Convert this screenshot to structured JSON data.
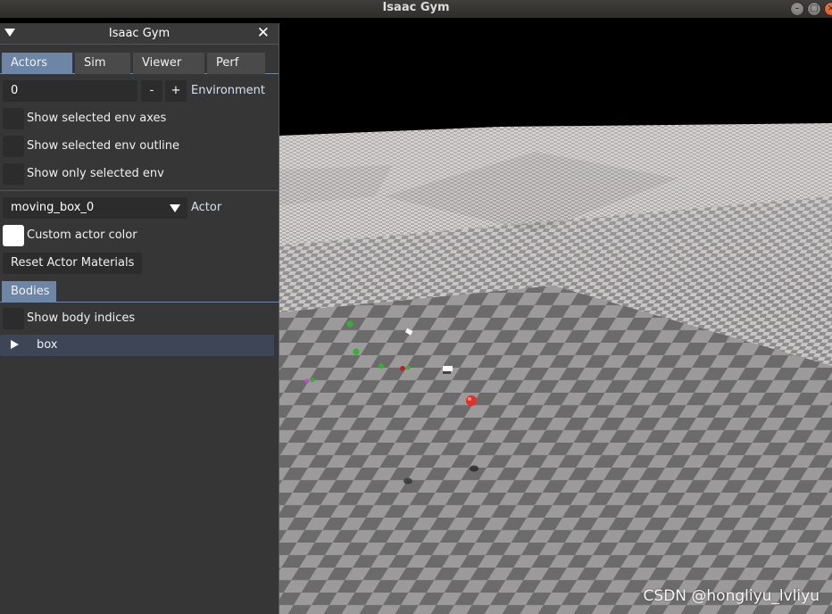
{
  "window": {
    "title": "Isaac Gym"
  },
  "panel": {
    "title": "Isaac Gym",
    "tabs": [
      {
        "label": "Actors",
        "active": true
      },
      {
        "label": "Sim",
        "active": false
      },
      {
        "label": "Viewer",
        "active": false
      },
      {
        "label": "Perf",
        "active": false
      }
    ],
    "environment": {
      "value": "0",
      "minus": "-",
      "plus": "+",
      "label": "Environment"
    },
    "env_checkboxes": [
      {
        "label": "Show selected env axes",
        "checked": false
      },
      {
        "label": "Show selected env outline",
        "checked": false
      },
      {
        "label": "Show only selected env",
        "checked": false
      }
    ],
    "actor": {
      "selected": "moving_box_0",
      "label": "Actor"
    },
    "custom_actor_color": {
      "label": "Custom actor color",
      "color": "#ffffff"
    },
    "reset_button": "Reset Actor Materials",
    "bodies_tab": "Bodies",
    "show_body_indices": {
      "label": "Show body indices",
      "checked": false
    },
    "body_tree": [
      {
        "label": "box",
        "expanded": false
      }
    ]
  },
  "watermark": "CSDN @hongliyu_lvliyu",
  "colors": {
    "active_tab": "#6e86a6",
    "panel_bg": "#383838",
    "field_bg": "#2c2c2c",
    "checker_light": "#9c9a9b",
    "checker_dark": "#6c6b6c",
    "red_sphere": "#e23028"
  }
}
